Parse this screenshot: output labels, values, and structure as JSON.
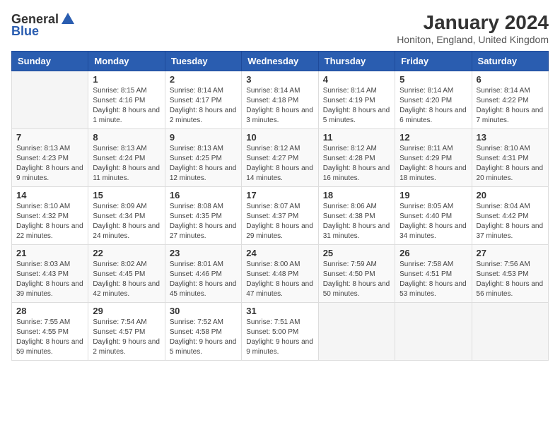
{
  "logo": {
    "general": "General",
    "blue": "Blue"
  },
  "title": "January 2024",
  "subtitle": "Honiton, England, United Kingdom",
  "days_of_week": [
    "Sunday",
    "Monday",
    "Tuesday",
    "Wednesday",
    "Thursday",
    "Friday",
    "Saturday"
  ],
  "weeks": [
    [
      {
        "day": "",
        "sunrise": "",
        "sunset": "",
        "daylight": ""
      },
      {
        "day": "1",
        "sunrise": "Sunrise: 8:15 AM",
        "sunset": "Sunset: 4:16 PM",
        "daylight": "Daylight: 8 hours and 1 minute."
      },
      {
        "day": "2",
        "sunrise": "Sunrise: 8:14 AM",
        "sunset": "Sunset: 4:17 PM",
        "daylight": "Daylight: 8 hours and 2 minutes."
      },
      {
        "day": "3",
        "sunrise": "Sunrise: 8:14 AM",
        "sunset": "Sunset: 4:18 PM",
        "daylight": "Daylight: 8 hours and 3 minutes."
      },
      {
        "day": "4",
        "sunrise": "Sunrise: 8:14 AM",
        "sunset": "Sunset: 4:19 PM",
        "daylight": "Daylight: 8 hours and 5 minutes."
      },
      {
        "day": "5",
        "sunrise": "Sunrise: 8:14 AM",
        "sunset": "Sunset: 4:20 PM",
        "daylight": "Daylight: 8 hours and 6 minutes."
      },
      {
        "day": "6",
        "sunrise": "Sunrise: 8:14 AM",
        "sunset": "Sunset: 4:22 PM",
        "daylight": "Daylight: 8 hours and 7 minutes."
      }
    ],
    [
      {
        "day": "7",
        "sunrise": "Sunrise: 8:13 AM",
        "sunset": "Sunset: 4:23 PM",
        "daylight": "Daylight: 8 hours and 9 minutes."
      },
      {
        "day": "8",
        "sunrise": "Sunrise: 8:13 AM",
        "sunset": "Sunset: 4:24 PM",
        "daylight": "Daylight: 8 hours and 11 minutes."
      },
      {
        "day": "9",
        "sunrise": "Sunrise: 8:13 AM",
        "sunset": "Sunset: 4:25 PM",
        "daylight": "Daylight: 8 hours and 12 minutes."
      },
      {
        "day": "10",
        "sunrise": "Sunrise: 8:12 AM",
        "sunset": "Sunset: 4:27 PM",
        "daylight": "Daylight: 8 hours and 14 minutes."
      },
      {
        "day": "11",
        "sunrise": "Sunrise: 8:12 AM",
        "sunset": "Sunset: 4:28 PM",
        "daylight": "Daylight: 8 hours and 16 minutes."
      },
      {
        "day": "12",
        "sunrise": "Sunrise: 8:11 AM",
        "sunset": "Sunset: 4:29 PM",
        "daylight": "Daylight: 8 hours and 18 minutes."
      },
      {
        "day": "13",
        "sunrise": "Sunrise: 8:10 AM",
        "sunset": "Sunset: 4:31 PM",
        "daylight": "Daylight: 8 hours and 20 minutes."
      }
    ],
    [
      {
        "day": "14",
        "sunrise": "Sunrise: 8:10 AM",
        "sunset": "Sunset: 4:32 PM",
        "daylight": "Daylight: 8 hours and 22 minutes."
      },
      {
        "day": "15",
        "sunrise": "Sunrise: 8:09 AM",
        "sunset": "Sunset: 4:34 PM",
        "daylight": "Daylight: 8 hours and 24 minutes."
      },
      {
        "day": "16",
        "sunrise": "Sunrise: 8:08 AM",
        "sunset": "Sunset: 4:35 PM",
        "daylight": "Daylight: 8 hours and 27 minutes."
      },
      {
        "day": "17",
        "sunrise": "Sunrise: 8:07 AM",
        "sunset": "Sunset: 4:37 PM",
        "daylight": "Daylight: 8 hours and 29 minutes."
      },
      {
        "day": "18",
        "sunrise": "Sunrise: 8:06 AM",
        "sunset": "Sunset: 4:38 PM",
        "daylight": "Daylight: 8 hours and 31 minutes."
      },
      {
        "day": "19",
        "sunrise": "Sunrise: 8:05 AM",
        "sunset": "Sunset: 4:40 PM",
        "daylight": "Daylight: 8 hours and 34 minutes."
      },
      {
        "day": "20",
        "sunrise": "Sunrise: 8:04 AM",
        "sunset": "Sunset: 4:42 PM",
        "daylight": "Daylight: 8 hours and 37 minutes."
      }
    ],
    [
      {
        "day": "21",
        "sunrise": "Sunrise: 8:03 AM",
        "sunset": "Sunset: 4:43 PM",
        "daylight": "Daylight: 8 hours and 39 minutes."
      },
      {
        "day": "22",
        "sunrise": "Sunrise: 8:02 AM",
        "sunset": "Sunset: 4:45 PM",
        "daylight": "Daylight: 8 hours and 42 minutes."
      },
      {
        "day": "23",
        "sunrise": "Sunrise: 8:01 AM",
        "sunset": "Sunset: 4:46 PM",
        "daylight": "Daylight: 8 hours and 45 minutes."
      },
      {
        "day": "24",
        "sunrise": "Sunrise: 8:00 AM",
        "sunset": "Sunset: 4:48 PM",
        "daylight": "Daylight: 8 hours and 47 minutes."
      },
      {
        "day": "25",
        "sunrise": "Sunrise: 7:59 AM",
        "sunset": "Sunset: 4:50 PM",
        "daylight": "Daylight: 8 hours and 50 minutes."
      },
      {
        "day": "26",
        "sunrise": "Sunrise: 7:58 AM",
        "sunset": "Sunset: 4:51 PM",
        "daylight": "Daylight: 8 hours and 53 minutes."
      },
      {
        "day": "27",
        "sunrise": "Sunrise: 7:56 AM",
        "sunset": "Sunset: 4:53 PM",
        "daylight": "Daylight: 8 hours and 56 minutes."
      }
    ],
    [
      {
        "day": "28",
        "sunrise": "Sunrise: 7:55 AM",
        "sunset": "Sunset: 4:55 PM",
        "daylight": "Daylight: 8 hours and 59 minutes."
      },
      {
        "day": "29",
        "sunrise": "Sunrise: 7:54 AM",
        "sunset": "Sunset: 4:57 PM",
        "daylight": "Daylight: 9 hours and 2 minutes."
      },
      {
        "day": "30",
        "sunrise": "Sunrise: 7:52 AM",
        "sunset": "Sunset: 4:58 PM",
        "daylight": "Daylight: 9 hours and 5 minutes."
      },
      {
        "day": "31",
        "sunrise": "Sunrise: 7:51 AM",
        "sunset": "Sunset: 5:00 PM",
        "daylight": "Daylight: 9 hours and 9 minutes."
      },
      {
        "day": "",
        "sunrise": "",
        "sunset": "",
        "daylight": ""
      },
      {
        "day": "",
        "sunrise": "",
        "sunset": "",
        "daylight": ""
      },
      {
        "day": "",
        "sunrise": "",
        "sunset": "",
        "daylight": ""
      }
    ]
  ]
}
